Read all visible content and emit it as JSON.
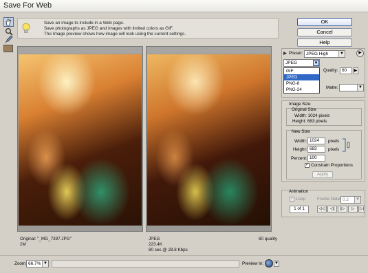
{
  "window": {
    "title": "Save For Web"
  },
  "info": {
    "line1": "Save an image to include in a Web page.",
    "line2": "Save photographs as JPEG and images with limited colors as GIF.",
    "line3": "The Image preview shows how image will look using the current settings."
  },
  "buttons": {
    "ok": "OK",
    "cancel": "Cancel",
    "help": "Help"
  },
  "preset": {
    "label": "Preset:",
    "value": "JPEG High"
  },
  "format": {
    "value": "JPEG",
    "options": [
      "GIF",
      "JPEG",
      "PNG-8",
      "PNG-24"
    ],
    "highlighted": "JPEG"
  },
  "quality": {
    "label": "Quality:",
    "value": "60"
  },
  "matte": {
    "label": "Matte:"
  },
  "image_size": {
    "title": "Image Size",
    "original": {
      "title": "Original Size",
      "width": "Width:  1024 pixels",
      "height": "Height:  683 pixels"
    },
    "new": {
      "title": "New Size",
      "width_label": "Width:",
      "width": "1024",
      "height_label": "Height:",
      "height": "683",
      "percent_label": "Percent:",
      "percent": "100",
      "unit": "pixels",
      "constrain": "Constrain Proportions",
      "apply": "Apply"
    }
  },
  "animation": {
    "title": "Animation",
    "loop": "Loop",
    "frame_delay_label": "Frame Delay:",
    "frame_delay": "0.2",
    "frame_counter": "1 of 1"
  },
  "original_pane": {
    "line1": "Original: \"_MG_7397.JPG\"",
    "line2": "2M"
  },
  "optimized_pane": {
    "line1": "JPEG",
    "line2": "223.4K",
    "line3": "80 sec @ 28.8 Kbps",
    "quality": "60 quality"
  },
  "footer": {
    "zoom_label": "Zoom:",
    "zoom": "66.7%",
    "preview_in": "Preview In:"
  },
  "colors": {
    "accent": "#3168c5",
    "button_border": "#3b5f9e"
  }
}
